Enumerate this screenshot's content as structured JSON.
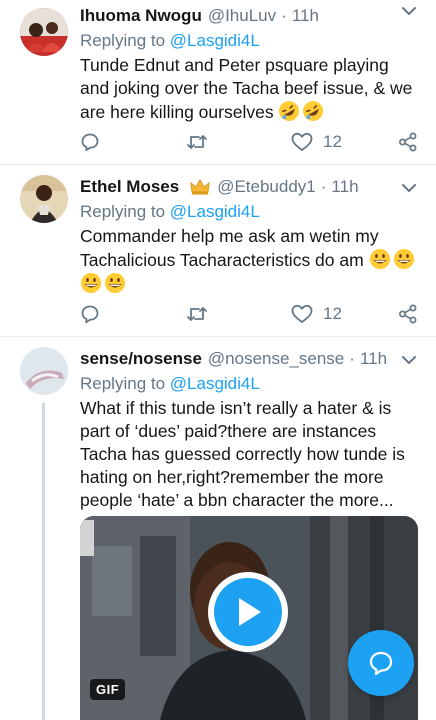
{
  "tweets": [
    {
      "name": "Ihuoma Nwogu",
      "handle": "@IhuLuv",
      "dot": "·",
      "time": "11h",
      "replying_prefix": "Replying to ",
      "replying_to": "@Lasgidi4L",
      "text": "Tunde Ednut and Peter psquare playing and joking over the Tacha beef issue, & we are here killing ourselves",
      "emojis": [
        "rolling-on-floor-laughing",
        "rolling-on-floor-laughing"
      ],
      "likes": "12"
    },
    {
      "name": "Ethel Moses",
      "handle": "@Etebuddy1",
      "dot": "·",
      "time": "11h",
      "replying_prefix": "Replying to ",
      "replying_to": "@Lasgidi4L",
      "text": "Commander help me ask am wetin my Tachalicious Tacharacteristics do am",
      "emojis": [
        "grinning-face",
        "grinning-face",
        "grinning-face",
        "grinning-face"
      ],
      "likes": "12"
    },
    {
      "name": "sense/nosense",
      "handle": "@nosense_sense",
      "dot": "·",
      "time": "11h",
      "replying_prefix": "Replying to ",
      "replying_to": "@Lasgidi4L",
      "text": "What if this tunde isn’t really a hater & is part of ‘dues’ paid?there are instances Tacha has guessed correctly how tunde is hating on her,right?remember the more people ‘hate’ a bbn character the more...",
      "media_badge": "GIF"
    }
  ],
  "icons": {
    "reply": "reply-icon",
    "retweet": "retweet-icon",
    "like": "heart-icon",
    "share": "share-icon",
    "caret": "chevron-down-icon",
    "compose": "compose-icon",
    "play": "play-icon"
  },
  "colors": {
    "accent": "#1da1f2",
    "secondary_text": "#657786",
    "divider": "#e6ecf0"
  }
}
